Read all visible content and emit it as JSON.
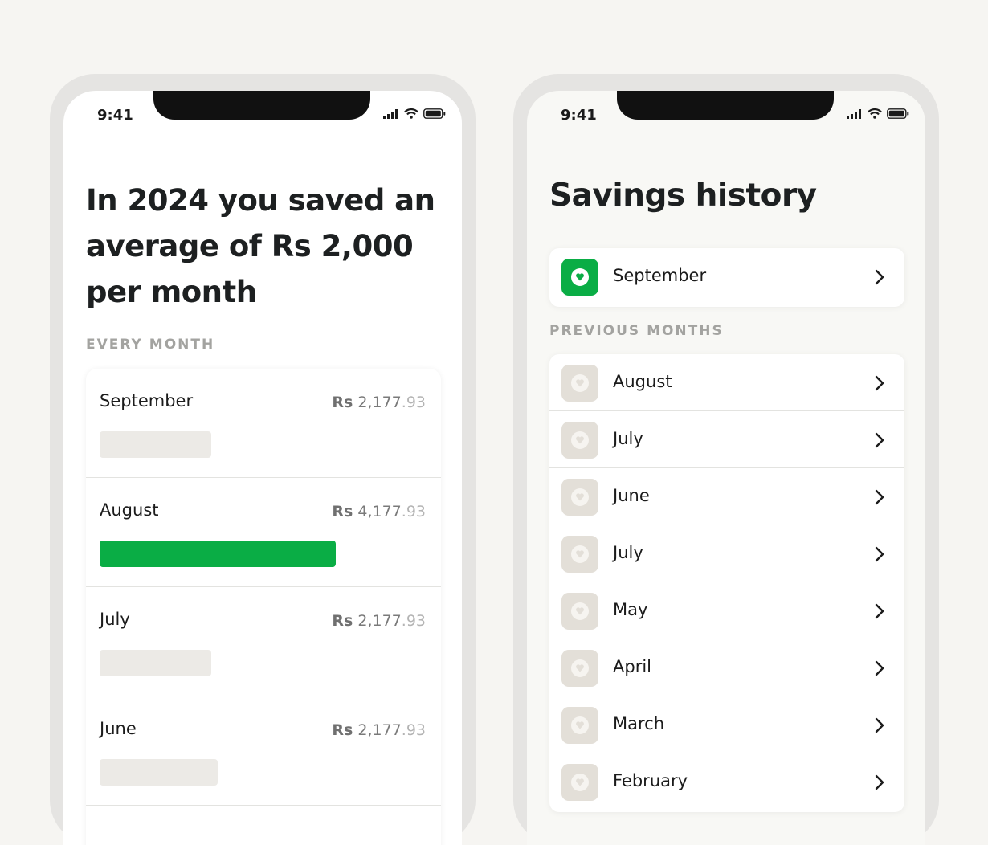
{
  "left_phone": {
    "status": {
      "time": "9:41"
    },
    "headline": "In 2024 you saved an average of Rs 2,000 per month",
    "section_label": "EVERY MONTH",
    "months": [
      {
        "name": "September",
        "currency": "Rs",
        "amount": "2,177",
        "decimals": ".93",
        "fill_fraction": 0.33,
        "active": false
      },
      {
        "name": "August",
        "currency": "Rs",
        "amount": "4,177",
        "decimals": ".93",
        "fill_fraction": 0.7,
        "active": true
      },
      {
        "name": "July",
        "currency": "Rs",
        "amount": "2,177",
        "decimals": ".93",
        "fill_fraction": 0.33,
        "active": false
      },
      {
        "name": "June",
        "currency": "Rs",
        "amount": "2,177",
        "decimals": ".93",
        "fill_fraction": 0.35,
        "active": false
      }
    ]
  },
  "right_phone": {
    "status": {
      "time": "9:41"
    },
    "title": "Savings history",
    "current": {
      "label": "September"
    },
    "section_label": "PREVIOUS MONTHS",
    "history": [
      {
        "label": "August"
      },
      {
        "label": "July"
      },
      {
        "label": "June"
      },
      {
        "label": "July"
      },
      {
        "label": "May"
      },
      {
        "label": "April"
      },
      {
        "label": "March"
      },
      {
        "label": "February"
      }
    ]
  },
  "colors": {
    "accent": "#0aad45",
    "inactive_bar": "#eceae6",
    "icon_inactive_bg": "#e3dfd8"
  }
}
